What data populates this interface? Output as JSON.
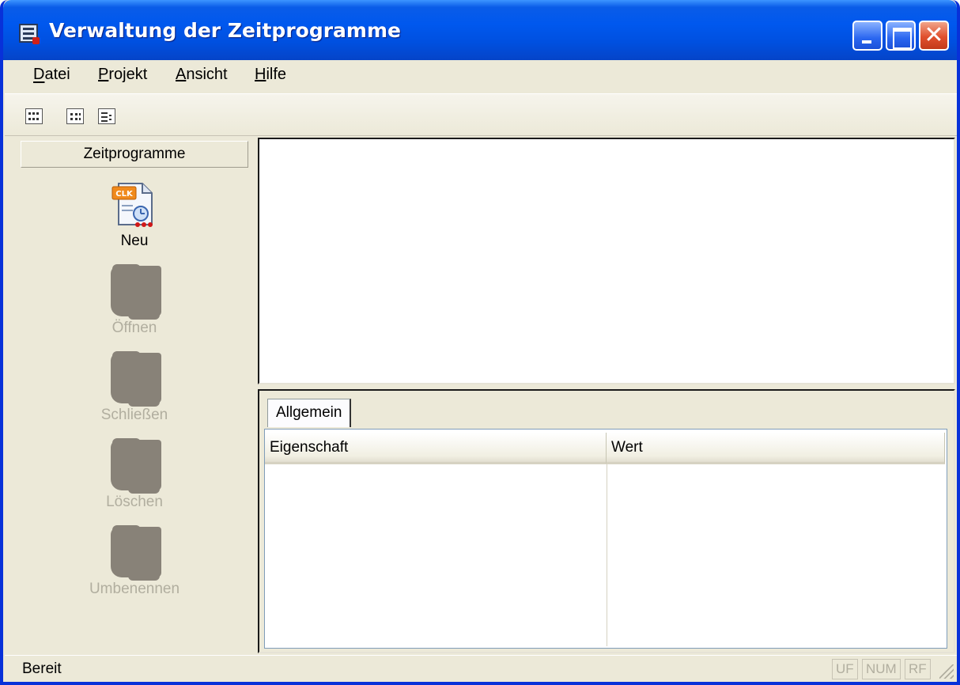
{
  "window": {
    "title": "Verwaltung der Zeitprogramme",
    "icon": "app-schedule-icon"
  },
  "menubar": {
    "items": [
      {
        "label": "Datei",
        "accel": "D"
      },
      {
        "label": "Projekt",
        "accel": "P"
      },
      {
        "label": "Ansicht",
        "accel": "A"
      },
      {
        "label": "Hilfe",
        "accel": "H"
      }
    ]
  },
  "toolbar": {
    "icons": [
      "large-icons-view-icon",
      "small-icons-view-icon",
      "list-view-icon"
    ]
  },
  "leftpane": {
    "header": "Zeitprogramme",
    "items": [
      {
        "label": "Neu",
        "icon": "new-clk-document-icon",
        "enabled": true
      },
      {
        "label": "Öffnen",
        "icon": "open-icon",
        "enabled": false
      },
      {
        "label": "Schließen",
        "icon": "close-doc-icon",
        "enabled": false
      },
      {
        "label": "Löschen",
        "icon": "delete-icon",
        "enabled": false
      },
      {
        "label": "Umbenennen",
        "icon": "rename-icon",
        "enabled": false
      }
    ]
  },
  "properties": {
    "tab": "Allgemein",
    "columns": [
      "Eigenschaft",
      "Wert"
    ]
  },
  "statusbar": {
    "text": "Bereit",
    "indicators": [
      "UF",
      "NUM",
      "RF"
    ]
  },
  "colors": {
    "titlebar": "#0058ee",
    "window_face": "#ece9d8",
    "disabled_text": "#b1ae9f"
  }
}
